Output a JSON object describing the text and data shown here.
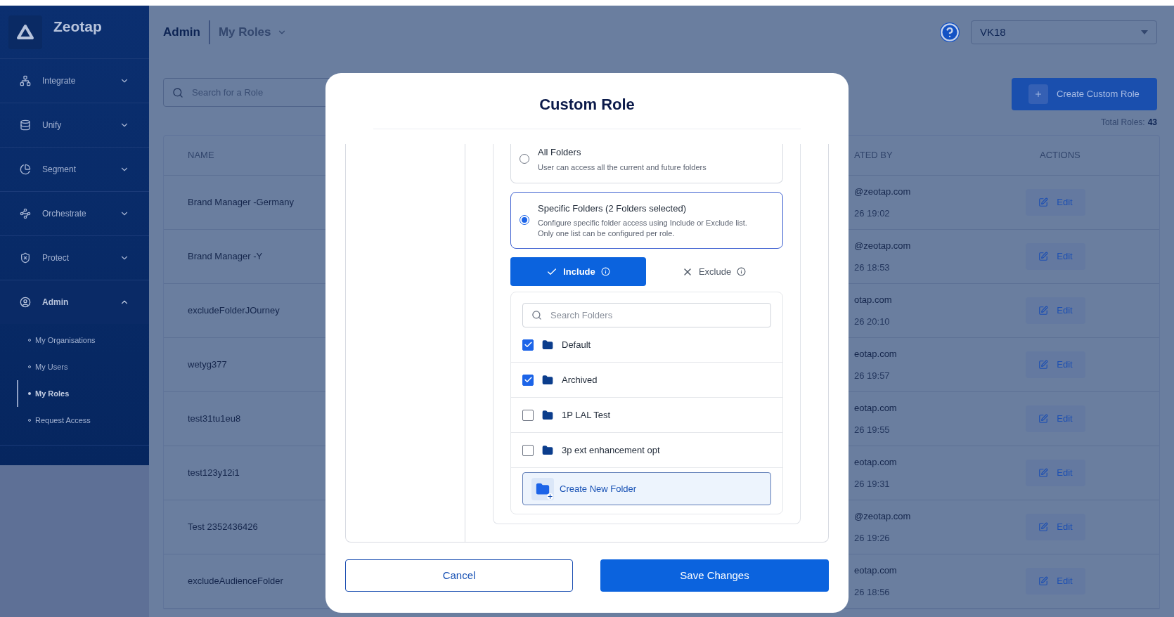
{
  "sidebar": {
    "logo": "Zeotap",
    "items": [
      {
        "label": "Integrate",
        "expanded": false
      },
      {
        "label": "Unify",
        "expanded": false
      },
      {
        "label": "Segment",
        "expanded": false
      },
      {
        "label": "Orchestrate",
        "expanded": false
      },
      {
        "label": "Protect",
        "expanded": false
      },
      {
        "label": "Admin",
        "expanded": true,
        "children": [
          {
            "label": "My Organisations",
            "selected": false
          },
          {
            "label": "My Users",
            "selected": false
          },
          {
            "label": "My Roles",
            "selected": true
          },
          {
            "label": "Request Access",
            "selected": false
          }
        ]
      }
    ]
  },
  "header": {
    "section": "Admin",
    "page": "My Roles",
    "organisation": "VK18"
  },
  "toolbar": {
    "search_placeholder": "Search for a Role",
    "create_button": "Create Custom Role",
    "total_label": "Total Roles:",
    "total_value": "43"
  },
  "table": {
    "columns": [
      "NAME",
      "ATED BY",
      "ACTIONS"
    ],
    "rows": [
      {
        "name": "Brand Manager -Germany",
        "created_by": "@zeotap.com",
        "created_at": "26 19:02",
        "action": "Edit"
      },
      {
        "name": "Brand Manager -Y",
        "created_by": "@zeotap.com",
        "created_at": "26 18:53",
        "action": "Edit"
      },
      {
        "name": "excludeFolderJOurney",
        "created_by": "otap.com",
        "created_at": "26 20:10",
        "action": "Edit"
      },
      {
        "name": "wetyg377",
        "created_by": "eotap.com",
        "created_at": "26 19:57",
        "action": "Edit"
      },
      {
        "name": "test31tu1eu8",
        "created_by": "eotap.com",
        "created_at": "26 19:55",
        "action": "Edit"
      },
      {
        "name": "test123y12i1",
        "created_by": "eotap.com",
        "created_at": "26 19:31",
        "action": "Edit"
      },
      {
        "name": "Test 2352436426",
        "created_by": "@zeotap.com",
        "created_at": "26 19:26",
        "action": "Edit"
      },
      {
        "name": "excludeAudienceFolder",
        "created_by": "eotap.com",
        "created_at": "26 18:56",
        "action": "Edit"
      }
    ]
  },
  "modal": {
    "title": "Custom Role",
    "access_options": [
      {
        "title": "All Folders",
        "description": "User can access all the current and future folders",
        "selected": false
      },
      {
        "title": "Specific Folders (2 Folders selected)",
        "description": "Configure specific folder access using Include or Exclude list. Only one list can be configured per role.",
        "selected": true
      }
    ],
    "list_modes": [
      {
        "kind": "include",
        "label": "Include",
        "selected": true
      },
      {
        "kind": "exclude",
        "label": "Exclude",
        "selected": false
      }
    ],
    "folder_search_placeholder": "Search Folders",
    "folders": [
      {
        "name": "Default",
        "checked": true
      },
      {
        "name": "Archived",
        "checked": true
      },
      {
        "name": "1P LAL Test",
        "checked": false
      },
      {
        "name": "3p ext enhancement opt",
        "checked": false
      }
    ],
    "create_folder": "Create New Folder",
    "cancel_button": "Cancel",
    "save_button": "Save Changes"
  }
}
